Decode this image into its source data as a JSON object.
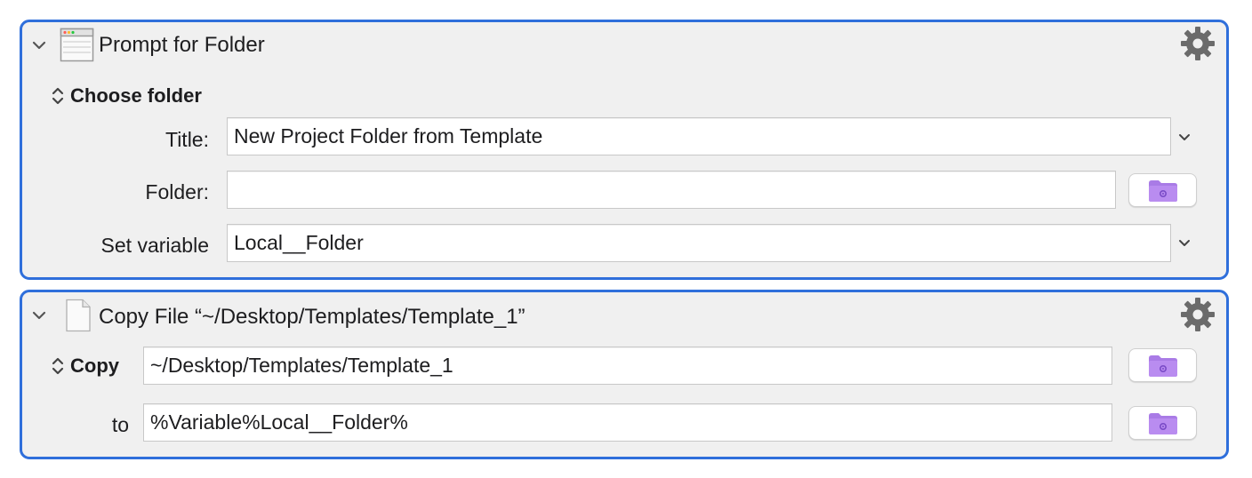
{
  "actions": [
    {
      "title": "Prompt for Folder",
      "icon": "window-icon",
      "mode_label": "Choose folder",
      "fields": {
        "title": {
          "label": "Title:",
          "value": "New Project Folder from Template"
        },
        "folder": {
          "label": "Folder:",
          "value": ""
        },
        "set_variable": {
          "label": "Set variable",
          "value": "Local__Folder"
        }
      }
    },
    {
      "title": "Copy File “~/Desktop/Templates/Template_1”",
      "icon": "document-icon",
      "mode_label": "Copy",
      "fields": {
        "source": {
          "value": "~/Desktop/Templates/Template_1"
        },
        "destination": {
          "label": "to",
          "value": "%Variable%Local__Folder%"
        }
      }
    }
  ],
  "colors": {
    "selection_border": "#2f6fdb",
    "action_background": "#f0f0f0",
    "folder_icon": "#a97be6",
    "gear_icon": "#6b6b6b"
  }
}
